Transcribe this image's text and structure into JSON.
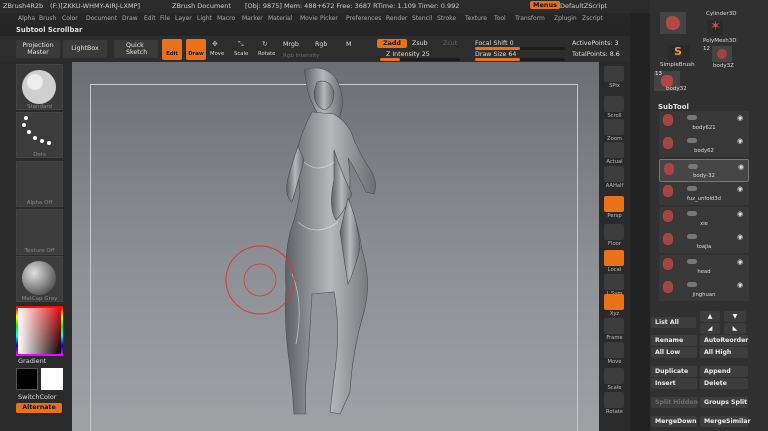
{
  "title": {
    "app": "ZBrush4R2b",
    "file": "(F:)[ZKKU-WHMY-AIRJ-LXMP]",
    "doc": "ZBrush Document",
    "stats": "[Obj: 9875] Mem: 488+672 Free: 3687 RTime: 1.109 Timer: 0.992",
    "menus": "Menus",
    "script": "DefaultZScript"
  },
  "menubar": [
    "Alpha",
    "Brush",
    "Color",
    "Document",
    "Draw",
    "Edit",
    "File",
    "Layer",
    "Light",
    "Macro",
    "Marker",
    "Material",
    "Movie",
    "Picker",
    "Preferences",
    "Render",
    "Stencil",
    "Stroke",
    "Texture",
    "Tool",
    "Transform",
    "Zplugin",
    "Zscript"
  ],
  "subtool_scrollbar": "Subtool Scrollbar",
  "toolbar": {
    "projection": "Projection Master",
    "lightbox": "LightBox",
    "quick_sketch": "Quick Sketch",
    "edit": "Edit",
    "draw": "Draw",
    "move": "Move",
    "scale": "Scale",
    "rotate": "Rotate",
    "mrgb": "Mrgb",
    "rgb": "Rgb",
    "m": "M",
    "zadd": "Zadd",
    "zsub": "Zsub",
    "zcut": "Zcut",
    "rgb_intensity": "Rgb Intensity",
    "z_intensity": "Z Intensity 25",
    "z_intensity_value": 25,
    "focal_shift": "Focal Shift 0",
    "draw_size": "Draw Size 64",
    "draw_size_value": 64,
    "active_points": "ActivePoints: 3",
    "total_points": "TotalPoints: 8.6"
  },
  "left_shelf": {
    "standard": "Standard",
    "dots": "Dots",
    "alpha": "Alpha Off",
    "texture": "Texture Off",
    "matcap": "MatCap Gray",
    "gradient": "Gradient",
    "switchcolor": "SwitchColor",
    "alternate": "Alternate"
  },
  "right_shelf": [
    "SPix",
    "Scroll",
    "Zoom",
    "Actual",
    "AAHalf",
    "Persp",
    "Floor",
    "Local",
    "L.Sym",
    "Xyz",
    "Frame",
    "Move",
    "Scale",
    "Rotate"
  ],
  "tray": {
    "tools": [
      "Cylinder3D",
      "PolyMesh3D",
      "SimpleBrush",
      "body3Z",
      "body32"
    ],
    "tool_counts": [
      "2",
      "12",
      "13"
    ],
    "subtool_header": "SubTool",
    "subtools": [
      "body621",
      "body62",
      "body-32",
      "fuz_unfold3d",
      "xie",
      "toajia",
      "head",
      "jinghuan"
    ],
    "buttons": {
      "list_all": "List All",
      "rename": "Rename",
      "autoreorder": "AutoReorder",
      "all_low": "All Low",
      "all_high": "All High",
      "duplicate": "Duplicate",
      "append": "Append",
      "insert": "Insert",
      "delete": "Delete",
      "split_hidden": "Split Hidden",
      "groups_split": "Groups Split",
      "merge_down": "MergeDown",
      "merge_similar": "MergeSimilar"
    }
  },
  "colors": {
    "accent": "#e8711a",
    "bg": "#252525",
    "canvas_top": "#6b6f73",
    "canvas_bottom": "#9ea2a5"
  }
}
